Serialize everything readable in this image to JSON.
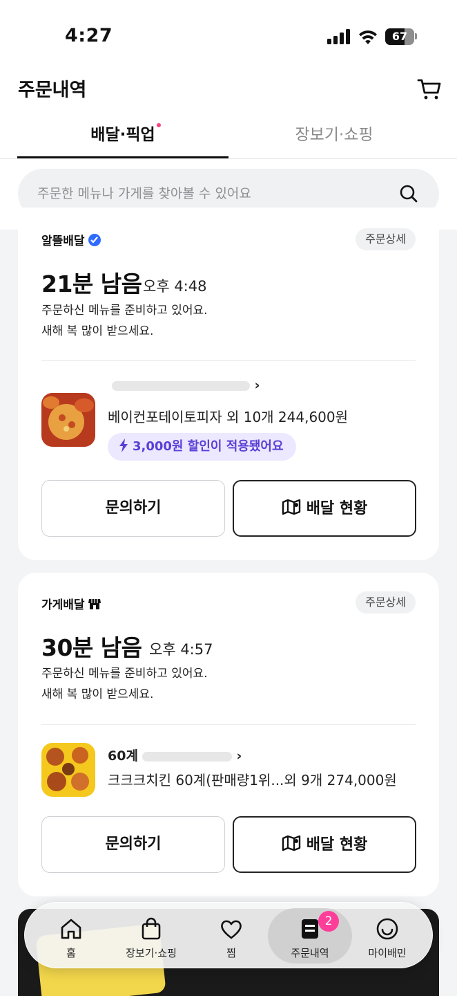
{
  "status_bar": {
    "time": "4:27",
    "battery": "67",
    "battery_level": 0.67
  },
  "header": {
    "title": "주문내역"
  },
  "tabs": [
    {
      "label": "배달·픽업",
      "active": true
    },
    {
      "label": "장보기·쇼핑",
      "active": false
    }
  ],
  "search": {
    "placeholder": "주문한 메뉴나 가게를 찾아볼 수 있어요"
  },
  "orders": [
    {
      "type": "알뜰배달",
      "detail_label": "주문상세",
      "remaining": "21분 남음",
      "eta": "오후 4:48",
      "message_line1": "주문하신 메뉴를 준비하고 있어요.",
      "message_line2": "새해 복 많이 받으세요.",
      "items": "베이컨포테이토피자 외 10개 244,600원",
      "discount": "3,000원 할인이 적용됐어요",
      "inquiry_label": "문의하기",
      "track_label": "배달 현황"
    },
    {
      "type": "가게배달",
      "detail_label": "주문상세",
      "remaining": "30분 남음",
      "eta": "오후 4:57",
      "message_line1": "주문하신 메뉴를 준비하고 있어요.",
      "message_line2": "새해 복 많이 받으세요.",
      "store_name_prefix": "60계",
      "items": "크크크치킨 60계(판매량1위...외 9개 274,000원",
      "inquiry_label": "문의하기",
      "track_label": "배달 현황"
    }
  ],
  "bottom_nav": {
    "items": [
      {
        "label": "홈",
        "icon": "home-icon"
      },
      {
        "label": "장보기·쇼핑",
        "icon": "shopping-bag-icon"
      },
      {
        "label": "찜",
        "icon": "heart-icon"
      },
      {
        "label": "주문내역",
        "icon": "order-list-icon",
        "active": true,
        "badge": "2"
      },
      {
        "label": "마이배민",
        "icon": "my-baemin-icon"
      }
    ]
  },
  "colors": {
    "accent_pink": "#ff3e9a",
    "discount_purple": "#5a3fd6",
    "badge_blue": "#2f6bff"
  }
}
